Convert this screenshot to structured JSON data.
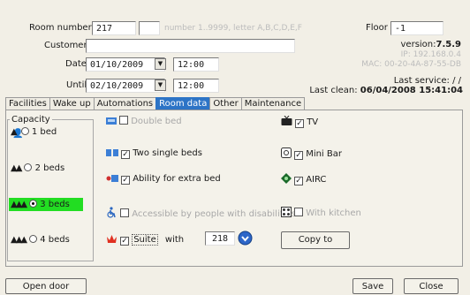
{
  "header": {
    "room_number_label": "Room number",
    "room_number": "217",
    "room_letter": "",
    "room_hint": "number 1..9999, letter A,B,C,D,E,F",
    "floor_label": "Floor",
    "floor": "-1",
    "customer_label": "Customer",
    "customer": "",
    "version_label": "version:",
    "version": "7.5.9",
    "ip": "IP: 192.168.0.4",
    "mac": "MAC: 00-20-4A-87-55-DB",
    "date_label": "Date",
    "date": "01/10/2009",
    "date_time": "12:00",
    "until_label": "Until",
    "until": "02/10/2009",
    "until_time": "12:00",
    "last_service": "Last service:  / /",
    "last_clean_label": "Last clean:",
    "last_clean": "06/04/2008 15:41:04"
  },
  "tabs": [
    "Facilities",
    "Wake up",
    "Automations",
    "Room data",
    "Other",
    "Maintenance"
  ],
  "active_tab": "Room data",
  "capacity": {
    "title": "Capacity",
    "options": [
      "1 bed",
      "2 beds",
      "3 beds",
      "4 beds"
    ],
    "selected": "3 beds"
  },
  "room_data": {
    "double_bed": "Double bed",
    "two_single_beds": "Two single beds",
    "extra_bed": "Ability for extra bed",
    "accessible": "Accessible by people with disabilities",
    "suite": "Suite",
    "with_label": "with",
    "suite_rooms": "218",
    "tv": "TV",
    "mini_bar": "Mini Bar",
    "airc": "AIRC",
    "kitchen": "With kitchen",
    "copy_to": "Copy to"
  },
  "footer": {
    "open_door": "Open door",
    "save": "Save",
    "close": "Close"
  },
  "colors": {
    "accent": "#2d74c6",
    "selected_bg": "#22dd22"
  }
}
